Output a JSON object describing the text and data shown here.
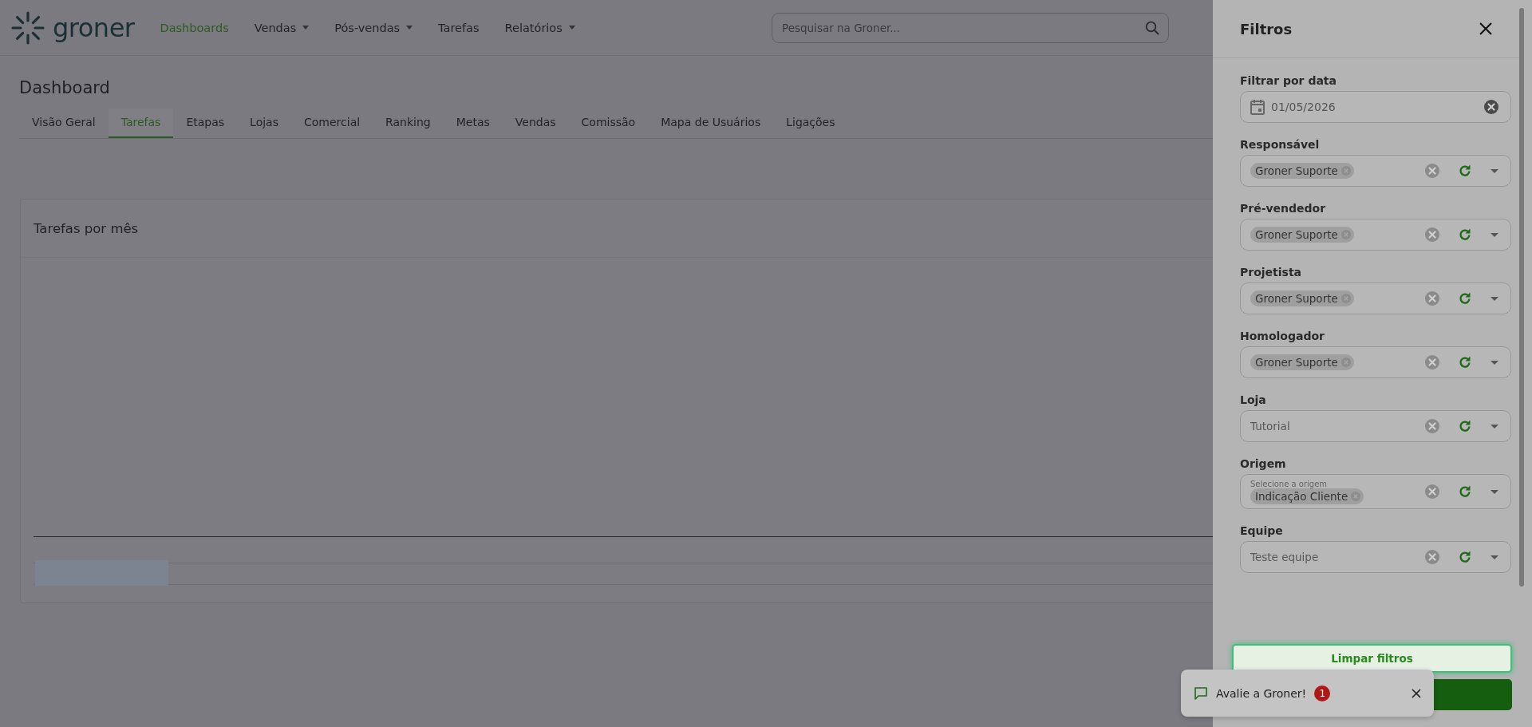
{
  "header": {
    "logo_text": "groner",
    "nav": [
      {
        "label": "Dashboards",
        "selected": true,
        "has_menu": false
      },
      {
        "label": "Vendas",
        "selected": false,
        "has_menu": true
      },
      {
        "label": "Pós-vendas",
        "selected": false,
        "has_menu": true
      },
      {
        "label": "Tarefas",
        "selected": false,
        "has_menu": false
      },
      {
        "label": "Relatórios",
        "selected": false,
        "has_menu": true
      }
    ],
    "search": {
      "placeholder": "Pesquisar na Groner..."
    }
  },
  "page": {
    "title": "Dashboard",
    "tabs": [
      {
        "label": "Visão Geral",
        "selected": false
      },
      {
        "label": "Tarefas",
        "selected": true
      },
      {
        "label": "Etapas",
        "selected": false
      },
      {
        "label": "Lojas",
        "selected": false
      },
      {
        "label": "Comercial",
        "selected": false
      },
      {
        "label": "Ranking",
        "selected": false
      },
      {
        "label": "Metas",
        "selected": false
      },
      {
        "label": "Vendas",
        "selected": false
      },
      {
        "label": "Comissão",
        "selected": false
      },
      {
        "label": "Mapa de Usuários",
        "selected": false
      },
      {
        "label": "Ligações",
        "selected": false
      }
    ]
  },
  "card": {
    "title": "Tarefas por mês",
    "zoom_slider": {
      "level": 0.09
    }
  },
  "filters": {
    "title": "Filtros",
    "fields": [
      {
        "kind": "date",
        "label": "Filtrar por data",
        "value": "01/05/2026"
      },
      {
        "kind": "chips",
        "label": "Responsável",
        "chips": [
          "Groner Suporte"
        ]
      },
      {
        "kind": "chips",
        "label": "Pré-vendedor",
        "chips": [
          "Groner Suporte"
        ]
      },
      {
        "kind": "chips",
        "label": "Projetista",
        "chips": [
          "Groner Suporte"
        ]
      },
      {
        "kind": "chips",
        "label": "Homologador",
        "chips": [
          "Groner Suporte"
        ]
      },
      {
        "kind": "select",
        "label": "Loja",
        "placeholder": "Tutorial"
      },
      {
        "kind": "chips",
        "label": "Origem",
        "floating_label": "Selecione a origem",
        "chips": [
          "Indicação Cliente"
        ]
      },
      {
        "kind": "select",
        "label": "Equipe",
        "placeholder": "Teste equipe"
      }
    ],
    "clear_button": "Limpar filtros"
  },
  "toast": {
    "text": "Avalie a Groner!",
    "badge": "1"
  }
}
